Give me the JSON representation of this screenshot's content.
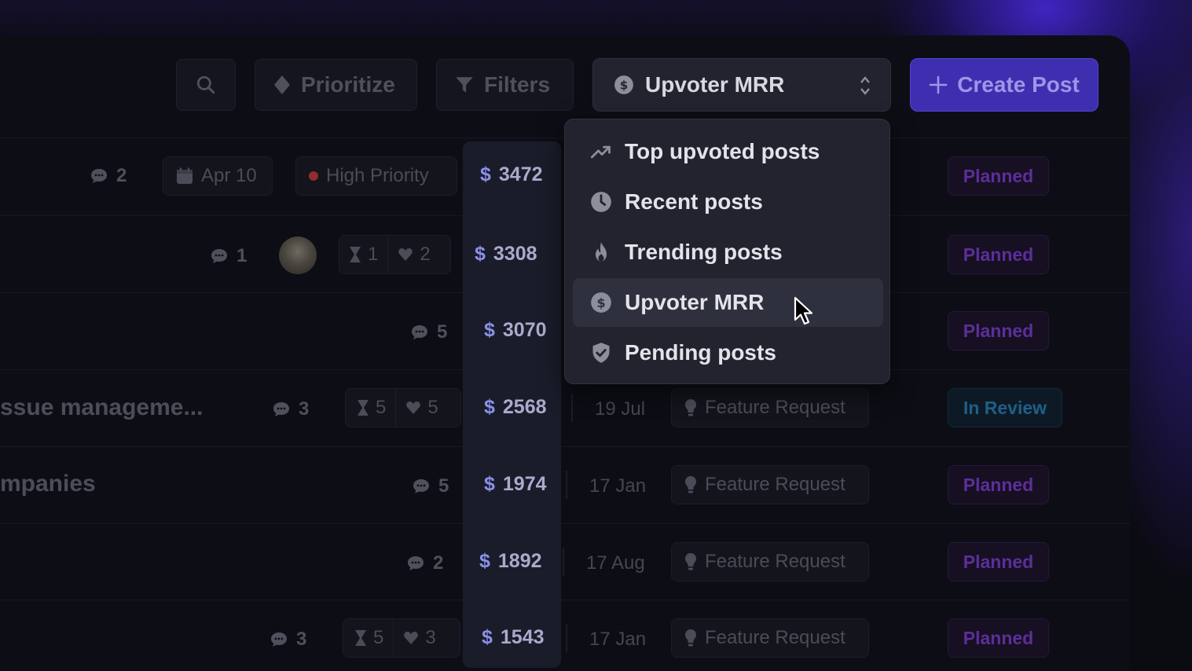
{
  "toolbar": {
    "prioritize_label": "Prioritize",
    "filters_label": "Filters",
    "sort_label": "Upvoter MRR",
    "create_label": "Create Post"
  },
  "sort_menu": {
    "items": [
      {
        "label": "Top upvoted posts",
        "icon": "trending-up-icon"
      },
      {
        "label": "Recent posts",
        "icon": "clock-icon"
      },
      {
        "label": "Trending posts",
        "icon": "fire-icon"
      },
      {
        "label": "Upvoter MRR",
        "icon": "dollar-circle-icon",
        "active": true
      },
      {
        "label": "Pending posts",
        "icon": "shield-check-icon"
      }
    ]
  },
  "rows": [
    {
      "comments": "2",
      "date_chip": "Apr 10",
      "priority": "High Priority",
      "mrr": "3472",
      "status": "Planned"
    },
    {
      "comments": "1",
      "votes": "1",
      "hearts": "2",
      "mrr": "3308",
      "status": "Planned"
    },
    {
      "comments": "5",
      "mrr": "3070",
      "status": "Planned"
    },
    {
      "title": "ssue manageme...",
      "comments": "3",
      "votes": "5",
      "hearts": "5",
      "mrr": "2568",
      "date": "19 Jul",
      "category": "Feature Request",
      "status": "In Review"
    },
    {
      "title": "mpanies",
      "comments": "5",
      "mrr": "1974",
      "date": "17 Jan",
      "category": "Feature Request",
      "status": "Planned"
    },
    {
      "comments": "2",
      "mrr": "1892",
      "date": "17 Aug",
      "category": "Feature Request",
      "status": "Planned"
    },
    {
      "comments": "3",
      "votes": "5",
      "hearts": "3",
      "mrr": "1543",
      "date": "17 Jan",
      "category": "Feature Request",
      "status": "Planned"
    }
  ],
  "currency_symbol": "$",
  "colors": {
    "accent": "#3d2fb0",
    "planned": "#5b2f9a",
    "in_review": "#1f5f88",
    "mrr": "#8a90e8"
  }
}
